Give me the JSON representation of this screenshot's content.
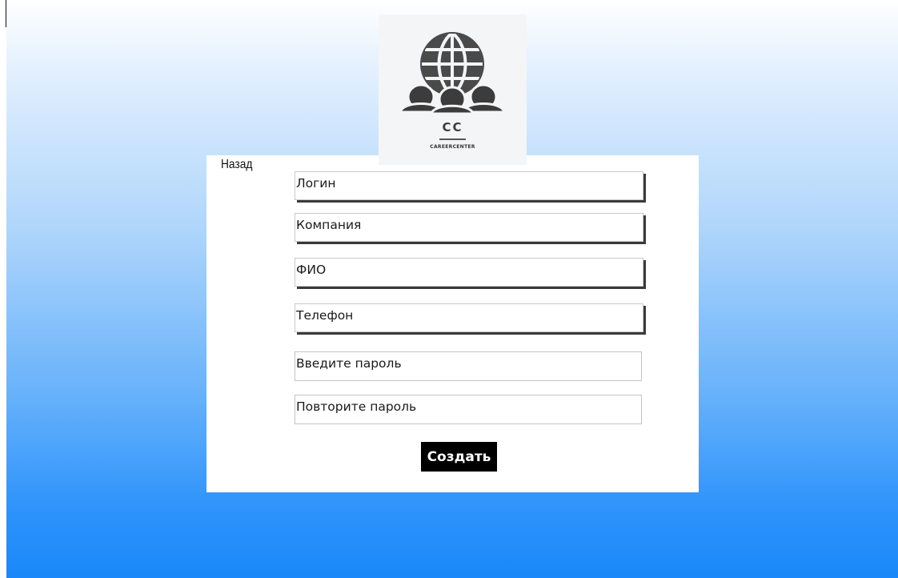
{
  "logo": {
    "icon": "globe-with-people-icon",
    "abbreviation": "CC",
    "name": "CAREERCENTER"
  },
  "nav": {
    "back_label": "Назад"
  },
  "form": {
    "login_placeholder": "Логин",
    "company_placeholder": "Компания",
    "fullname_placeholder": "ФИО",
    "phone_placeholder": "Телефон",
    "password_placeholder": "Введите пароль",
    "repeat_password_placeholder": "Повторите пароль",
    "submit_label": "Создать"
  },
  "colors": {
    "background_top": "#ffffff",
    "background_bottom": "#1a88fa",
    "card": "#ffffff",
    "button": "#000000",
    "button_text": "#ffffff"
  }
}
